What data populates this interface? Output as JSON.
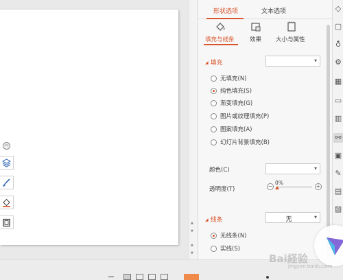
{
  "pane": {
    "tabs": {
      "shape": "形状选项",
      "text": "文本选项"
    },
    "subtabs": {
      "fill_line": "填充与线条",
      "effect": "效果",
      "size_props": "大小与属性"
    },
    "fill_section": {
      "title": "填充",
      "dropdown_value": "",
      "options": [
        "无填充(N)",
        "纯色填充(S)",
        "渐变填充(G)",
        "图片或纹理填充(P)",
        "图案填充(A)",
        "幻灯片背景填充(B)"
      ],
      "selected": "纯色填充(S)",
      "color_label": "颜色(C)",
      "transparency_label": "透明度(T)",
      "transparency_value": "0%"
    },
    "line_section": {
      "title": "线条",
      "dropdown_value": "无",
      "options": [
        "无线条(N)",
        "实线(S)"
      ],
      "selected": "无线条(N)"
    }
  },
  "watermark": {
    "text": "Bai経验",
    "sub": "jingyan.baidu.com"
  },
  "colors": {
    "accent": "#d9552b",
    "play": "#f08a4b"
  }
}
